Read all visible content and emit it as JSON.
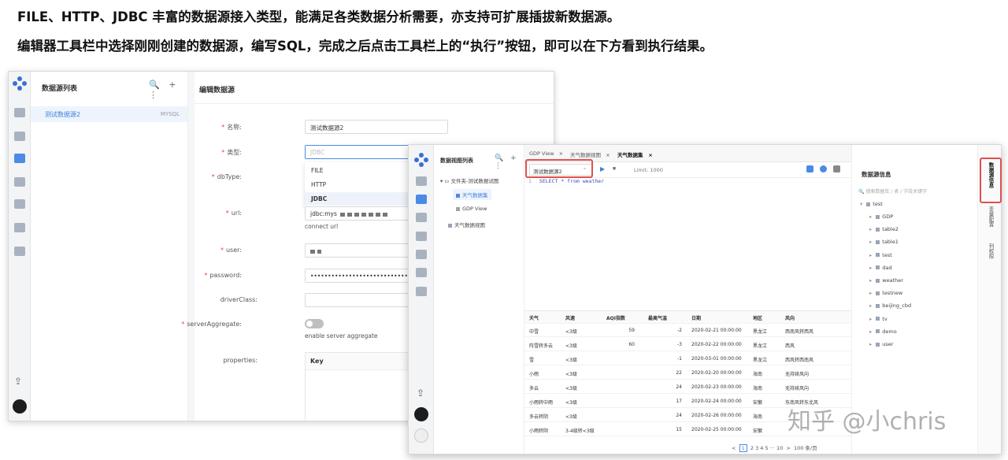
{
  "captions": {
    "line1": "FILE、HTTP、JDBC 丰富的数据源接入类型，能满足各类数据分析需要，亦支持可扩展插拔新数据源。",
    "line2": "编辑器工具栏中选择刚刚创建的数据源，编写SQL，完成之后点击工具栏上的“执行”按钮，即可以在下方看到执行结果。"
  },
  "datasource_window": {
    "list_title": "数据源列表",
    "tools": "🔍 + ⋮",
    "row": {
      "name": "测试数据源2",
      "type": "MYSQL"
    },
    "form_title": "编辑数据源",
    "fields": {
      "name": {
        "label": "名称:",
        "value": "测试数据源2"
      },
      "type": {
        "label": "类型:",
        "placeholder": "JDBC"
      },
      "dbtype": {
        "label": "dbType:"
      },
      "url": {
        "label": "url:",
        "value": "jdbc:mys",
        "hint": "connect url"
      },
      "user": {
        "label": "user:"
      },
      "password": {
        "label": "password:",
        "value": "••••••••••••••••••••••••••••••••"
      },
      "driver": {
        "label": "driverClass:"
      },
      "aggregate": {
        "label": "serverAggregate:",
        "hint": "enable server aggregate"
      },
      "properties": {
        "label": "properties:",
        "key_header": "Key"
      }
    },
    "type_options": [
      "FILE",
      "HTTP",
      "JDBC"
    ]
  },
  "editor_window": {
    "tree_title": "数据视图列表",
    "tree_tools": "🔍 + ⋮",
    "tree": {
      "folder": "文件夹-测试数据试图",
      "item1": "天气数据集",
      "item2": "GDP View",
      "item3": "天气数据视图"
    },
    "tabs": [
      "GDP View",
      "天气数据视图",
      "天气数据集"
    ],
    "tab_close": "×",
    "toolbar": {
      "datasource": "测试数据源2",
      "play": "▶",
      "stop": "⏹",
      "limit": "Limit: 1000"
    },
    "sql": {
      "line_no": "1",
      "text": "SELECT * from weather"
    },
    "grid": {
      "columns": [
        "天气",
        "风速",
        "AQI指数",
        "最高气温",
        "日期",
        "地区",
        "风向"
      ],
      "rows": [
        [
          "中雪",
          "<3级",
          "59",
          "-2",
          "2020-02-21 00:00:00",
          "黑龙江",
          "西南风转西风"
        ],
        [
          "阵雪转多云",
          "<3级",
          "60",
          "-3",
          "2020-02-22 00:00:00",
          "黑龙江",
          "西风"
        ],
        [
          "雪",
          "<3级",
          "",
          "-1",
          "2020-03-01 00:00:00",
          "黑龙江",
          "西风转西南风"
        ],
        [
          "小雨",
          "<3级",
          "",
          "22",
          "2020-02-20 00:00:00",
          "海南",
          "无持续风向"
        ],
        [
          "多云",
          "<3级",
          "",
          "24",
          "2020-02-23 00:00:00",
          "海南",
          "无持续风向"
        ],
        [
          "小雨转中雨",
          "<3级",
          "",
          "17",
          "2020-02-24 00:00:00",
          "安徽",
          "东南风转东北风"
        ],
        [
          "多云转阴",
          "<3级",
          "",
          "24",
          "2020-02-26 00:00:00",
          "海南",
          ""
        ],
        [
          "小雨转阴",
          "3-4级转<3级",
          "",
          "15",
          "2020-02-25 00:00:00",
          "安徽",
          ""
        ]
      ]
    },
    "pager": {
      "prev": "<",
      "current": "1",
      "pages": "2  3  4  5  ···  10",
      "next": ">",
      "size": "100 条/页"
    },
    "info": {
      "title": "数据源信息",
      "search_placeholder": "搜索数据库 / 表 / 字段关键字",
      "root": "test",
      "tables": [
        "GDP",
        "table2",
        "table1",
        "test",
        "dad",
        "weather",
        "testnew",
        "beijing_cbd",
        "tv",
        "demo",
        "user"
      ]
    },
    "vtabs": [
      "数据源信息",
      "变量配置",
      "列权限"
    ]
  },
  "watermark": "知乎 @小chris",
  "colors": {
    "accent": "#4b8ae6",
    "highlight": "#e05050"
  }
}
